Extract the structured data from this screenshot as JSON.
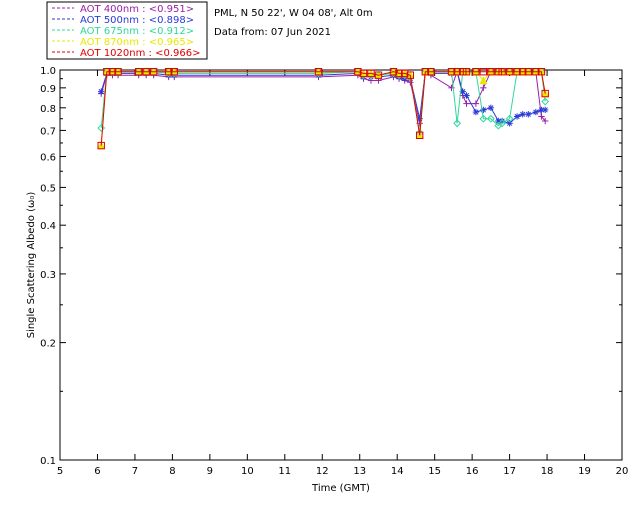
{
  "header": {
    "site_line": "PML, N 50 22', W 04 08', Alt 0m",
    "date_line": "Data from: 07 Jun 2021"
  },
  "legend": [
    {
      "label": "AOT  400nm : <0.951>",
      "color": "#9a1fa8"
    },
    {
      "label": "AOT  500nm : <0.898>",
      "color": "#2a3ad8"
    },
    {
      "label": "AOT  675nm : <0.912>",
      "color": "#2ed89a"
    },
    {
      "label": "AOT  870nm : <0.965>",
      "color": "#e8e800"
    },
    {
      "label": "AOT 1020nm : <0.966>",
      "color": "#e00000"
    }
  ],
  "chart_data": {
    "type": "line",
    "xlabel": "Time (GMT)",
    "ylabel": "Single Scattering Albedo (ω₀)",
    "xlim": [
      5,
      20
    ],
    "ylim": [
      0.1,
      1.0
    ],
    "yscale": "log",
    "xticks": [
      5,
      6,
      7,
      8,
      9,
      10,
      11,
      12,
      13,
      14,
      15,
      16,
      17,
      18,
      19,
      20
    ],
    "yticks": [
      0.1,
      0.2,
      0.3,
      0.4,
      0.5,
      0.6,
      0.7,
      0.8,
      0.9,
      1.0
    ],
    "ytick_labels": [
      "0.1",
      "0.2",
      "0.3",
      "0.4",
      "0.5",
      "0.6",
      "0.7",
      "0.8",
      "0.9",
      "1.0"
    ],
    "series": [
      {
        "name": "AOT  400nm : <0.951>",
        "color": "#9a1fa8",
        "marker": "plus",
        "x": [
          6.1,
          6.25,
          6.4,
          6.55,
          7.1,
          7.3,
          7.5,
          7.9,
          8.05,
          11.9,
          12.95,
          13.1,
          13.3,
          13.5,
          13.9,
          14.05,
          14.2,
          14.35,
          14.6,
          14.75,
          14.9,
          15.45,
          15.6,
          15.75,
          15.85,
          16.1,
          16.3,
          16.5,
          16.7,
          16.8,
          17.0,
          17.2,
          17.35,
          17.5,
          17.7,
          17.85,
          17.95
        ],
        "y": [
          0.87,
          0.97,
          0.97,
          0.97,
          0.97,
          0.97,
          0.97,
          0.96,
          0.96,
          0.96,
          0.97,
          0.95,
          0.94,
          0.94,
          0.96,
          0.95,
          0.94,
          0.93,
          0.73,
          0.99,
          0.97,
          0.9,
          0.99,
          0.86,
          0.82,
          0.82,
          0.9,
          0.99,
          0.99,
          0.99,
          0.99,
          0.99,
          0.99,
          0.99,
          0.99,
          0.76,
          0.74
        ]
      },
      {
        "name": "AOT  500nm : <0.898>",
        "color": "#2a3ad8",
        "marker": "star",
        "x": [
          6.1,
          6.25,
          6.4,
          6.55,
          7.1,
          7.3,
          7.5,
          7.9,
          8.05,
          11.9,
          12.95,
          13.1,
          13.3,
          13.5,
          13.9,
          14.05,
          14.2,
          14.35,
          14.6,
          14.75,
          14.9,
          15.45,
          15.6,
          15.75,
          15.85,
          16.1,
          16.3,
          16.5,
          16.7,
          16.8,
          17.0,
          17.2,
          17.35,
          17.5,
          17.7,
          17.85,
          17.95
        ],
        "y": [
          0.88,
          0.98,
          0.98,
          0.98,
          0.98,
          0.98,
          0.98,
          0.97,
          0.97,
          0.97,
          0.98,
          0.96,
          0.96,
          0.96,
          0.97,
          0.96,
          0.95,
          0.95,
          0.75,
          0.99,
          0.98,
          0.98,
          0.99,
          0.88,
          0.86,
          0.78,
          0.79,
          0.8,
          0.74,
          0.74,
          0.73,
          0.76,
          0.77,
          0.77,
          0.78,
          0.79,
          0.79
        ]
      },
      {
        "name": "AOT  675nm : <0.912>",
        "color": "#2ed89a",
        "marker": "diamond",
        "x": [
          6.1,
          6.25,
          6.4,
          6.55,
          7.1,
          7.3,
          7.5,
          7.9,
          8.05,
          11.9,
          12.95,
          13.1,
          13.3,
          13.5,
          13.9,
          14.05,
          14.2,
          14.35,
          14.6,
          14.75,
          14.9,
          15.45,
          15.6,
          15.75,
          15.85,
          16.1,
          16.3,
          16.5,
          16.7,
          16.8,
          17.0,
          17.2,
          17.35,
          17.5,
          17.7,
          17.85,
          17.95
        ],
        "y": [
          0.71,
          0.99,
          0.99,
          0.99,
          0.99,
          0.99,
          0.99,
          0.98,
          0.98,
          0.98,
          0.99,
          0.97,
          0.97,
          0.97,
          0.98,
          0.97,
          0.97,
          0.96,
          0.69,
          0.99,
          0.99,
          0.99,
          0.73,
          0.99,
          0.99,
          0.99,
          0.75,
          0.75,
          0.72,
          0.73,
          0.75,
          0.99,
          0.99,
          0.99,
          0.99,
          0.99,
          0.83
        ]
      },
      {
        "name": "AOT  870nm : <0.965>",
        "color": "#e8e800",
        "marker": "triangle",
        "x": [
          6.1,
          6.25,
          6.4,
          6.55,
          7.1,
          7.3,
          7.5,
          7.9,
          8.05,
          11.9,
          12.95,
          13.1,
          13.3,
          13.5,
          13.9,
          14.05,
          14.2,
          14.35,
          14.6,
          14.75,
          14.9,
          15.45,
          15.6,
          15.75,
          15.85,
          16.1,
          16.3,
          16.5,
          16.7,
          16.8,
          17.0,
          17.2,
          17.35,
          17.5,
          17.7,
          17.85,
          17.95
        ],
        "y": [
          0.64,
          0.99,
          0.99,
          0.99,
          0.99,
          0.99,
          0.99,
          0.99,
          0.99,
          0.99,
          0.99,
          0.98,
          0.98,
          0.97,
          0.99,
          0.98,
          0.98,
          0.97,
          0.68,
          0.99,
          0.99,
          0.99,
          0.99,
          0.99,
          0.99,
          0.99,
          0.94,
          0.99,
          0.99,
          0.99,
          0.99,
          0.99,
          0.99,
          0.99,
          0.99,
          0.99,
          0.87
        ]
      },
      {
        "name": "AOT 1020nm : <0.966>",
        "color": "#e00000",
        "marker": "square",
        "x": [
          6.1,
          6.25,
          6.4,
          6.55,
          7.1,
          7.3,
          7.5,
          7.9,
          8.05,
          11.9,
          12.95,
          13.1,
          13.3,
          13.5,
          13.9,
          14.05,
          14.2,
          14.35,
          14.6,
          14.75,
          14.9,
          15.45,
          15.6,
          15.75,
          15.85,
          16.1,
          16.3,
          16.5,
          16.7,
          16.8,
          17.0,
          17.2,
          17.35,
          17.5,
          17.7,
          17.85,
          17.95
        ],
        "y": [
          0.64,
          0.99,
          0.99,
          0.99,
          0.99,
          0.99,
          0.99,
          0.99,
          0.99,
          0.99,
          0.99,
          0.98,
          0.98,
          0.97,
          0.99,
          0.98,
          0.98,
          0.97,
          0.68,
          0.99,
          0.99,
          0.99,
          0.99,
          0.99,
          0.99,
          0.99,
          0.99,
          0.99,
          0.99,
          0.99,
          0.99,
          0.99,
          0.99,
          0.99,
          0.99,
          0.99,
          0.87
        ]
      }
    ]
  }
}
